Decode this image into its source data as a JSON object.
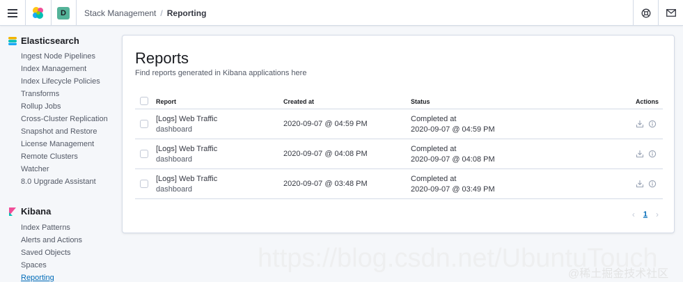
{
  "header": {
    "avatar_letter": "D",
    "breadcrumbs": [
      "Stack Management",
      "Reporting"
    ],
    "icons": [
      "menu-icon",
      "elastic-logo",
      "help-icon",
      "mail-icon"
    ]
  },
  "sidebar": {
    "sections": [
      {
        "title": "Elasticsearch",
        "items": [
          "Ingest Node Pipelines",
          "Index Management",
          "Index Lifecycle Policies",
          "Transforms",
          "Rollup Jobs",
          "Cross-Cluster Replication",
          "Snapshot and Restore",
          "License Management",
          "Remote Clusters",
          "Watcher",
          "8.0 Upgrade Assistant"
        ]
      },
      {
        "title": "Kibana",
        "items": [
          "Index Patterns",
          "Alerts and Actions",
          "Saved Objects",
          "Spaces",
          "Reporting"
        ]
      }
    ],
    "active_item": "Reporting"
  },
  "main": {
    "title": "Reports",
    "description": "Find reports generated in Kibana applications here",
    "columns": [
      "Report",
      "Created at",
      "Status",
      "Actions"
    ],
    "rows": [
      {
        "title": "[Logs] Web Traffic",
        "type": "dashboard",
        "created": "2020-09-07 @ 04:59 PM",
        "status": "Completed at",
        "status_time": "2020-09-07 @ 04:59 PM"
      },
      {
        "title": "[Logs] Web Traffic",
        "type": "dashboard",
        "created": "2020-09-07 @ 04:08 PM",
        "status": "Completed at",
        "status_time": "2020-09-07 @ 04:08 PM"
      },
      {
        "title": "[Logs] Web Traffic",
        "type": "dashboard",
        "created": "2020-09-07 @ 03:48 PM",
        "status": "Completed at",
        "status_time": "2020-09-07 @ 03:49 PM"
      }
    ],
    "pagination": {
      "current": "1"
    }
  },
  "watermark": {
    "url": "https://blog.csdn.net/UbuntuTouch",
    "label": "@稀土掘金技术社区"
  },
  "colors": {
    "accent": "#006bb8",
    "border": "#d3dae6",
    "avatar": "#54b399"
  }
}
